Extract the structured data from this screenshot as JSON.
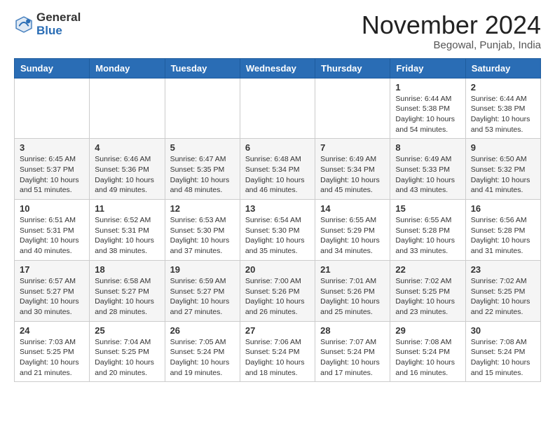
{
  "header": {
    "logo_general": "General",
    "logo_blue": "Blue",
    "month_title": "November 2024",
    "location": "Begowal, Punjab, India"
  },
  "weekdays": [
    "Sunday",
    "Monday",
    "Tuesday",
    "Wednesday",
    "Thursday",
    "Friday",
    "Saturday"
  ],
  "weeks": [
    [
      {
        "day": "",
        "info": ""
      },
      {
        "day": "",
        "info": ""
      },
      {
        "day": "",
        "info": ""
      },
      {
        "day": "",
        "info": ""
      },
      {
        "day": "",
        "info": ""
      },
      {
        "day": "1",
        "info": "Sunrise: 6:44 AM\nSunset: 5:38 PM\nDaylight: 10 hours\nand 54 minutes."
      },
      {
        "day": "2",
        "info": "Sunrise: 6:44 AM\nSunset: 5:38 PM\nDaylight: 10 hours\nand 53 minutes."
      }
    ],
    [
      {
        "day": "3",
        "info": "Sunrise: 6:45 AM\nSunset: 5:37 PM\nDaylight: 10 hours\nand 51 minutes."
      },
      {
        "day": "4",
        "info": "Sunrise: 6:46 AM\nSunset: 5:36 PM\nDaylight: 10 hours\nand 49 minutes."
      },
      {
        "day": "5",
        "info": "Sunrise: 6:47 AM\nSunset: 5:35 PM\nDaylight: 10 hours\nand 48 minutes."
      },
      {
        "day": "6",
        "info": "Sunrise: 6:48 AM\nSunset: 5:34 PM\nDaylight: 10 hours\nand 46 minutes."
      },
      {
        "day": "7",
        "info": "Sunrise: 6:49 AM\nSunset: 5:34 PM\nDaylight: 10 hours\nand 45 minutes."
      },
      {
        "day": "8",
        "info": "Sunrise: 6:49 AM\nSunset: 5:33 PM\nDaylight: 10 hours\nand 43 minutes."
      },
      {
        "day": "9",
        "info": "Sunrise: 6:50 AM\nSunset: 5:32 PM\nDaylight: 10 hours\nand 41 minutes."
      }
    ],
    [
      {
        "day": "10",
        "info": "Sunrise: 6:51 AM\nSunset: 5:31 PM\nDaylight: 10 hours\nand 40 minutes."
      },
      {
        "day": "11",
        "info": "Sunrise: 6:52 AM\nSunset: 5:31 PM\nDaylight: 10 hours\nand 38 minutes."
      },
      {
        "day": "12",
        "info": "Sunrise: 6:53 AM\nSunset: 5:30 PM\nDaylight: 10 hours\nand 37 minutes."
      },
      {
        "day": "13",
        "info": "Sunrise: 6:54 AM\nSunset: 5:30 PM\nDaylight: 10 hours\nand 35 minutes."
      },
      {
        "day": "14",
        "info": "Sunrise: 6:55 AM\nSunset: 5:29 PM\nDaylight: 10 hours\nand 34 minutes."
      },
      {
        "day": "15",
        "info": "Sunrise: 6:55 AM\nSunset: 5:28 PM\nDaylight: 10 hours\nand 33 minutes."
      },
      {
        "day": "16",
        "info": "Sunrise: 6:56 AM\nSunset: 5:28 PM\nDaylight: 10 hours\nand 31 minutes."
      }
    ],
    [
      {
        "day": "17",
        "info": "Sunrise: 6:57 AM\nSunset: 5:27 PM\nDaylight: 10 hours\nand 30 minutes."
      },
      {
        "day": "18",
        "info": "Sunrise: 6:58 AM\nSunset: 5:27 PM\nDaylight: 10 hours\nand 28 minutes."
      },
      {
        "day": "19",
        "info": "Sunrise: 6:59 AM\nSunset: 5:27 PM\nDaylight: 10 hours\nand 27 minutes."
      },
      {
        "day": "20",
        "info": "Sunrise: 7:00 AM\nSunset: 5:26 PM\nDaylight: 10 hours\nand 26 minutes."
      },
      {
        "day": "21",
        "info": "Sunrise: 7:01 AM\nSunset: 5:26 PM\nDaylight: 10 hours\nand 25 minutes."
      },
      {
        "day": "22",
        "info": "Sunrise: 7:02 AM\nSunset: 5:25 PM\nDaylight: 10 hours\nand 23 minutes."
      },
      {
        "day": "23",
        "info": "Sunrise: 7:02 AM\nSunset: 5:25 PM\nDaylight: 10 hours\nand 22 minutes."
      }
    ],
    [
      {
        "day": "24",
        "info": "Sunrise: 7:03 AM\nSunset: 5:25 PM\nDaylight: 10 hours\nand 21 minutes."
      },
      {
        "day": "25",
        "info": "Sunrise: 7:04 AM\nSunset: 5:25 PM\nDaylight: 10 hours\nand 20 minutes."
      },
      {
        "day": "26",
        "info": "Sunrise: 7:05 AM\nSunset: 5:24 PM\nDaylight: 10 hours\nand 19 minutes."
      },
      {
        "day": "27",
        "info": "Sunrise: 7:06 AM\nSunset: 5:24 PM\nDaylight: 10 hours\nand 18 minutes."
      },
      {
        "day": "28",
        "info": "Sunrise: 7:07 AM\nSunset: 5:24 PM\nDaylight: 10 hours\nand 17 minutes."
      },
      {
        "day": "29",
        "info": "Sunrise: 7:08 AM\nSunset: 5:24 PM\nDaylight: 10 hours\nand 16 minutes."
      },
      {
        "day": "30",
        "info": "Sunrise: 7:08 AM\nSunset: 5:24 PM\nDaylight: 10 hours\nand 15 minutes."
      }
    ]
  ]
}
